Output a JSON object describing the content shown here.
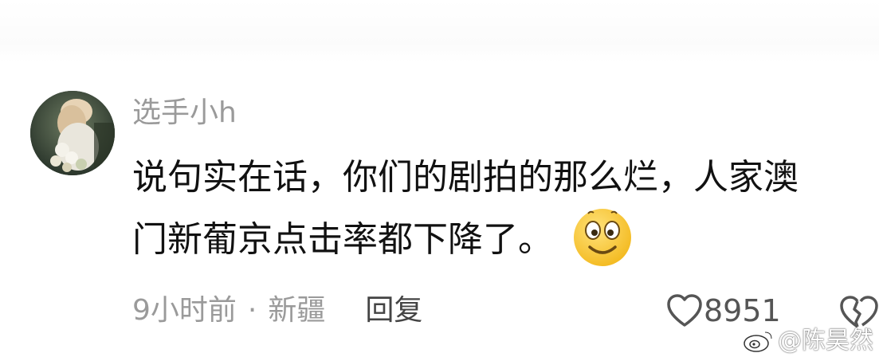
{
  "comment": {
    "username": "选手小h",
    "text_lines": [
      "说句实在话，你们的剧拍的那么烂，人家澳",
      "门新葡京点击率都下降了。"
    ],
    "emoji": "smile-emoji",
    "time": "9小时前",
    "separator": "·",
    "location": "新疆",
    "reply_label": "回复",
    "like_count": "8951"
  },
  "watermark": {
    "text": "@陈昊然"
  },
  "icons": {
    "like": "heart-icon",
    "dislike": "broken-heart-icon",
    "watermark_logo": "weibo-logo"
  }
}
